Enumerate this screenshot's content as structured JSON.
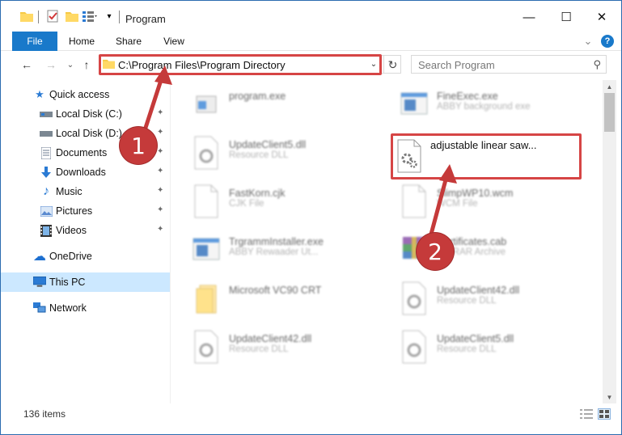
{
  "window": {
    "title": "Program",
    "controls": {
      "minimize": "—",
      "maximize": "☐",
      "close": "✕"
    }
  },
  "ribbon": {
    "tabs": [
      "File",
      "Home",
      "Share",
      "View"
    ],
    "expand_glyph": "⌄",
    "help_glyph": "?"
  },
  "address": {
    "path": "C:\\Program Files\\Program Directory",
    "dropdown_glyph": "⌄",
    "refresh_glyph": "↻"
  },
  "search": {
    "placeholder": "Search Program",
    "icon_glyph": "⚲"
  },
  "nav_glyphs": {
    "back": "←",
    "forward": "→",
    "recent": "⌄",
    "up": "↑",
    "pin": "📌"
  },
  "sidebar": {
    "items": [
      {
        "label": "Quick access",
        "icon": "star-icon",
        "glyph": "★",
        "color": "#2b7bd4",
        "pinned": false
      },
      {
        "label": "Local Disk (C:)",
        "icon": "drive-icon",
        "glyph": "▭",
        "color": "#5f6b75",
        "pinned": true
      },
      {
        "label": "Local Disk (D:)",
        "icon": "drive-icon",
        "glyph": "▭",
        "color": "#5f6b75",
        "pinned": true
      },
      {
        "label": "Documents",
        "icon": "documents-icon",
        "glyph": "▤",
        "color": "#5a6f8a",
        "pinned": true
      },
      {
        "label": "Downloads",
        "icon": "download-icon",
        "glyph": "⬇",
        "color": "#2b7bd4",
        "pinned": true
      },
      {
        "label": "Music",
        "icon": "music-icon",
        "glyph": "♪",
        "color": "#2b7bd4",
        "pinned": true
      },
      {
        "label": "Pictures",
        "icon": "pictures-icon",
        "glyph": "▨",
        "color": "#5a8ad0",
        "pinned": true
      },
      {
        "label": "Videos",
        "icon": "video-icon",
        "glyph": "▦",
        "color": "#444444",
        "pinned": true
      },
      {
        "label": "OneDrive",
        "icon": "cloud-icon",
        "glyph": "☁",
        "color": "#1d6fd0",
        "pinned": false
      },
      {
        "label": "This PC",
        "icon": "computer-icon",
        "glyph": "▭",
        "color": "#2b7bd4",
        "pinned": false
      },
      {
        "label": "Network",
        "icon": "network-icon",
        "glyph": "⧉",
        "color": "#2b7bd4",
        "pinned": false
      }
    ]
  },
  "files": [
    {
      "name": "program.exe",
      "desc": "",
      "icon": "exe-icon"
    },
    {
      "name": "FineExec.exe",
      "desc": "ABBY background exe",
      "icon": "app-window-icon"
    },
    {
      "name": "UpdateClient5.dll",
      "desc": "Resource DLL",
      "icon": "dll-icon"
    },
    {
      "name": "adjustable linear saw...",
      "desc": "",
      "icon": "settings-file-icon"
    },
    {
      "name": "FastKorn.cjk",
      "desc": "CJK File",
      "icon": "generic-file-icon"
    },
    {
      "name": "SlimpWP10.wcm",
      "desc": "WCM File",
      "icon": "generic-file-icon"
    },
    {
      "name": "TrgrammInstaller.exe",
      "desc": "ABBY Rewaader Ut...",
      "icon": "app-window-icon"
    },
    {
      "name": "Certificates.cab",
      "desc": "WinRAR Archive",
      "icon": "archive-icon"
    },
    {
      "name": "Microsoft VC90 CRT",
      "desc": "",
      "icon": "folder-icon"
    },
    {
      "name": "UpdateClient42.dll",
      "desc": "Resource DLL",
      "icon": "dll-icon"
    },
    {
      "name": "UpdateClient42.dll",
      "desc": "Resource DLL",
      "icon": "dll-icon"
    },
    {
      "name": "UpdateClient5.dll",
      "desc": "Resource DLL",
      "icon": "dll-icon"
    }
  ],
  "callouts": [
    "1",
    "2"
  ],
  "status": {
    "item_count": "136 items"
  },
  "colors": {
    "accent": "#1979ca",
    "callout": "#c53a3a",
    "selection": "#cce8ff"
  }
}
